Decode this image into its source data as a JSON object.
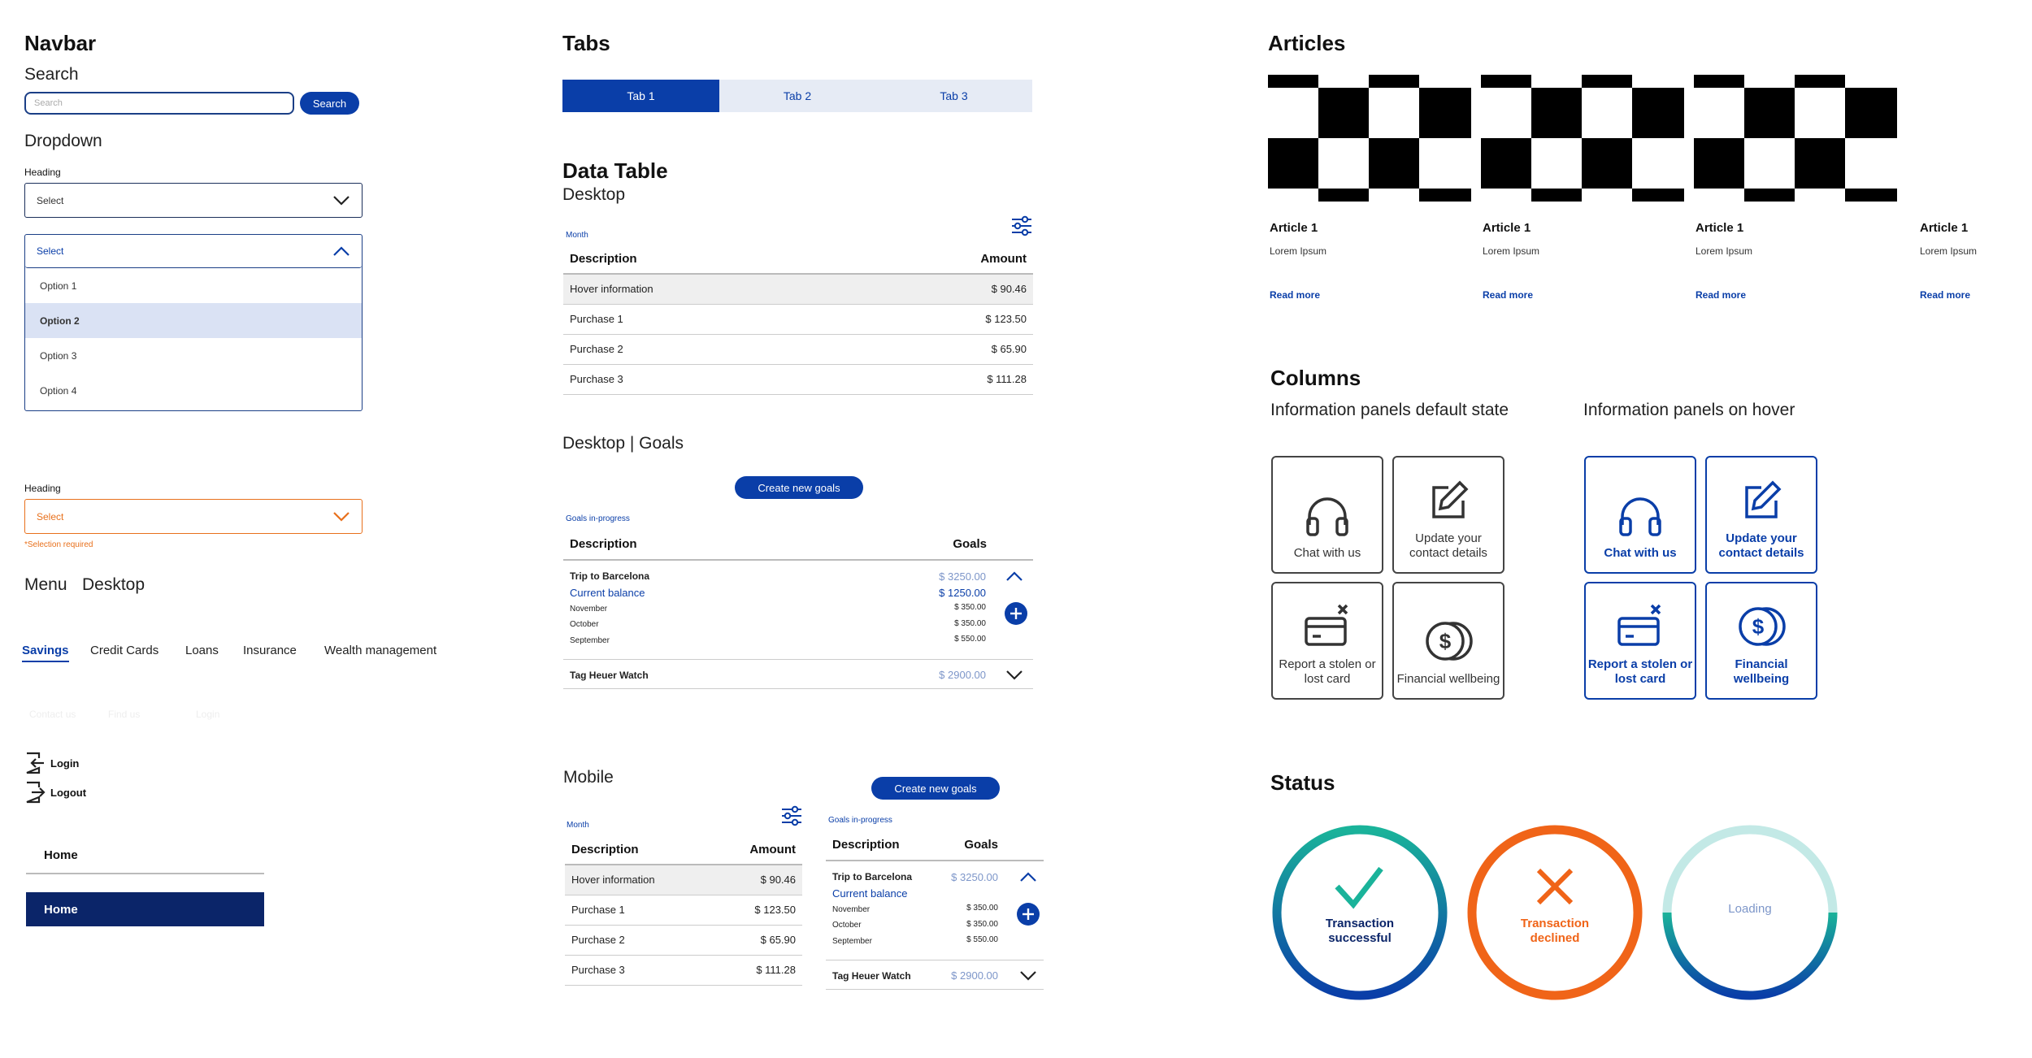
{
  "navbar": {
    "title": "Navbar",
    "search_title": "Search",
    "search_placeholder": "Search",
    "search_button": "Search",
    "dropdown_title": "Dropdown",
    "heading1": "Heading",
    "select1": "Select",
    "select_open": "Select",
    "options": [
      "Option 1",
      "Option 2",
      "Option 3",
      "Option 4"
    ],
    "heading2": "Heading",
    "select_error": "Select",
    "error_text": "*Selection required",
    "menu_title": "Menu",
    "menu_sub": "Desktop",
    "menu_items": [
      "Savings",
      "Credit Cards",
      "Loans",
      "Insurance",
      "Wealth management"
    ],
    "ghost_items": [
      "Contact us",
      "Find us",
      "Login"
    ],
    "login": "Login",
    "logout": "Logout",
    "home1": "Home",
    "home2": "Home"
  },
  "tabs": {
    "title": "Tabs",
    "items": [
      "Tab 1",
      "Tab 2",
      "Tab 3"
    ]
  },
  "datatable": {
    "title": "Data Table",
    "desktop": "Desktop",
    "caption": "Month",
    "col_desc": "Description",
    "col_amount": "Amount",
    "rows": [
      {
        "desc": "Hover information",
        "amount": "$ 90.46"
      },
      {
        "desc": "Purchase 1",
        "amount": "$ 123.50"
      },
      {
        "desc": "Purchase 2",
        "amount": "$ 65.90"
      },
      {
        "desc": "Purchase 3",
        "amount": "$ 111.28"
      }
    ],
    "goals_title": "Desktop | Goals",
    "create_goals": "Create new goals",
    "goals_caption": "Goals in-progress",
    "col_goals": "Goals",
    "goal1_name": "Trip to Barcelona",
    "goal1_amount": "$ 3250.00",
    "goal1_balance_label": "Current balance",
    "goal1_balance": "$ 1250.00",
    "goal1_months": [
      {
        "m": "November",
        "v": "$ 350.00"
      },
      {
        "m": "October",
        "v": "$ 350.00"
      },
      {
        "m": "September",
        "v": "$ 550.00"
      }
    ],
    "goal2_name": "Tag Heuer Watch",
    "goal2_amount": "$ 2900.00",
    "mobile_title": "Mobile"
  },
  "articles": {
    "title": "Articles",
    "items": [
      {
        "title": "Article 1",
        "body": "Lorem Ipsum",
        "link": "Read more"
      },
      {
        "title": "Article 1",
        "body": "Lorem Ipsum",
        "link": "Read more"
      },
      {
        "title": "Article 1",
        "body": "Lorem Ipsum",
        "link": "Read more"
      },
      {
        "title": "Article 1",
        "body": "Lorem Ipsum",
        "link": "Read more"
      }
    ]
  },
  "columns": {
    "title": "Columns",
    "default_label": "Information panels default state",
    "hover_label": "Information panels on hover",
    "cards": [
      {
        "icon": "headphones-icon",
        "label": "Chat with us"
      },
      {
        "icon": "edit-icon",
        "label": "Update your contact details"
      },
      {
        "icon": "card-cancel-icon",
        "label": "Report a stolen or lost card"
      },
      {
        "icon": "coins-icon",
        "label": "Financial wellbeing"
      }
    ]
  },
  "status": {
    "title": "Status",
    "success": "Transaction successful",
    "declined": "Transaction declined",
    "loading": "Loading"
  },
  "colors": {
    "primary": "#0a3ea8",
    "navy": "#0b2569",
    "orange": "#f06418",
    "teal": "#1ab39a"
  }
}
